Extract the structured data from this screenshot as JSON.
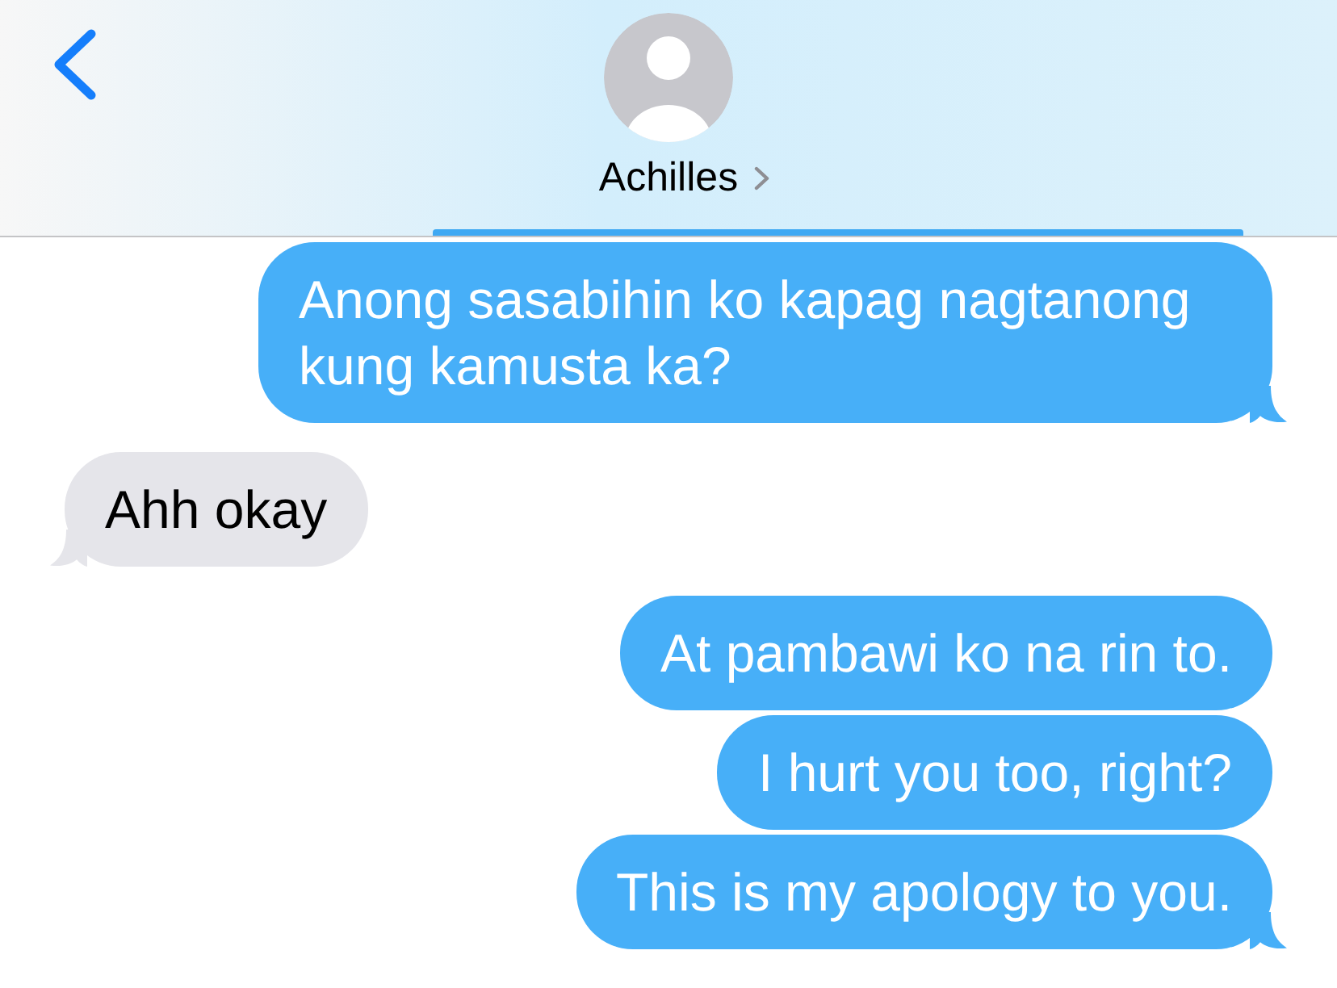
{
  "header": {
    "contact": {
      "name": "Achilles"
    }
  },
  "messages": [
    {
      "kind": "sent",
      "text": "Anong sasabihin ko kapag nagtanong kung kamusta ka?",
      "tail": true
    },
    {
      "kind": "received",
      "text": "Ahh okay",
      "tail": true
    },
    {
      "kind": "sent",
      "text": "At pambawi ko na rin to.",
      "tail": false
    },
    {
      "kind": "sent",
      "text": "I hurt you too, right?",
      "tail": false
    },
    {
      "kind": "sent",
      "text": "This is my apology to you.",
      "tail": true
    }
  ]
}
